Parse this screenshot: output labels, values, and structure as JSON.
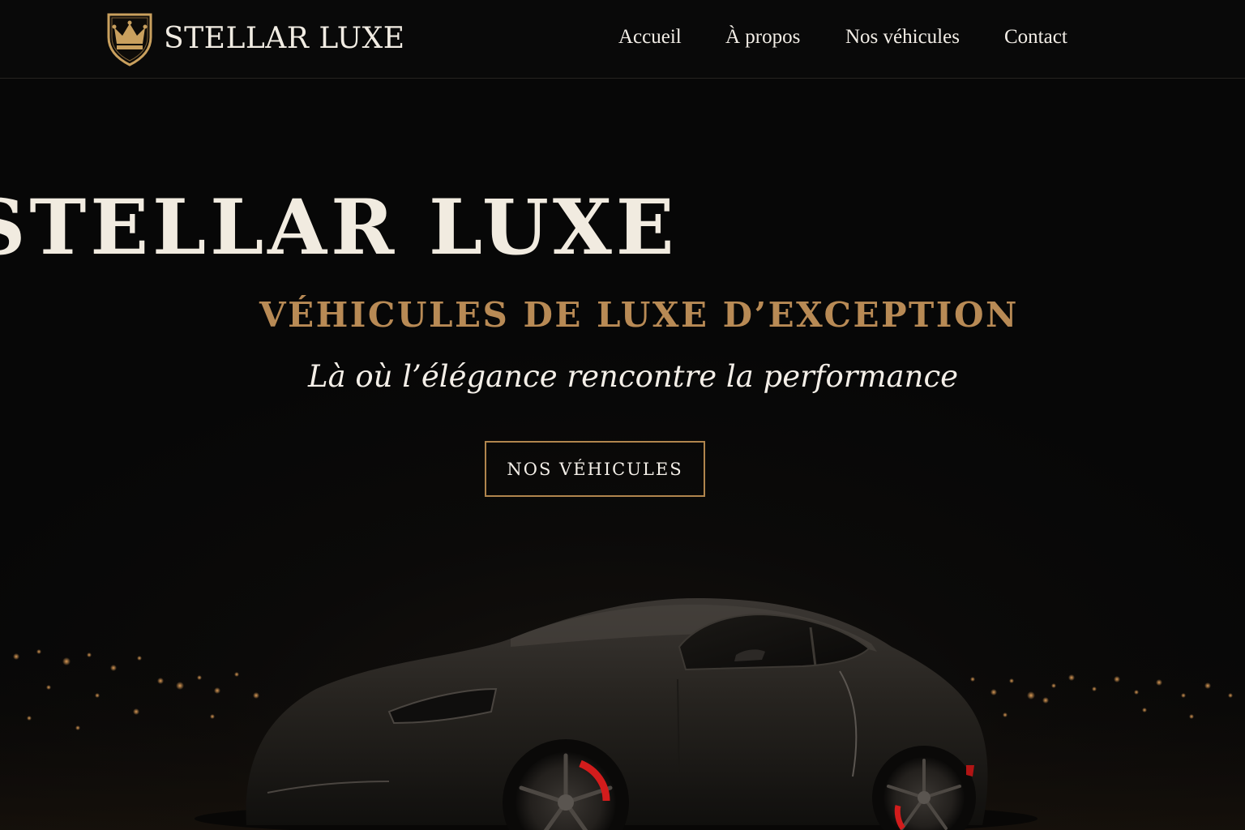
{
  "brand": {
    "name": "STELLAR LUXE",
    "logo_icon": "crown-shield-icon",
    "accent_color": "#b88a55"
  },
  "nav": {
    "items": [
      {
        "label": "Accueil"
      },
      {
        "label": "À propos"
      },
      {
        "label": "Nos véhicules"
      },
      {
        "label": "Contact"
      }
    ]
  },
  "hero": {
    "title": "STELLAR LUXE",
    "subtitle": "VÉHICULES DE LUXE D’EXCEPTION",
    "tagline": "Là où l’élégance rencontre la performance",
    "cta_label": "NOS VÉHICULES",
    "image": "dark-sports-car-city-night-image"
  }
}
